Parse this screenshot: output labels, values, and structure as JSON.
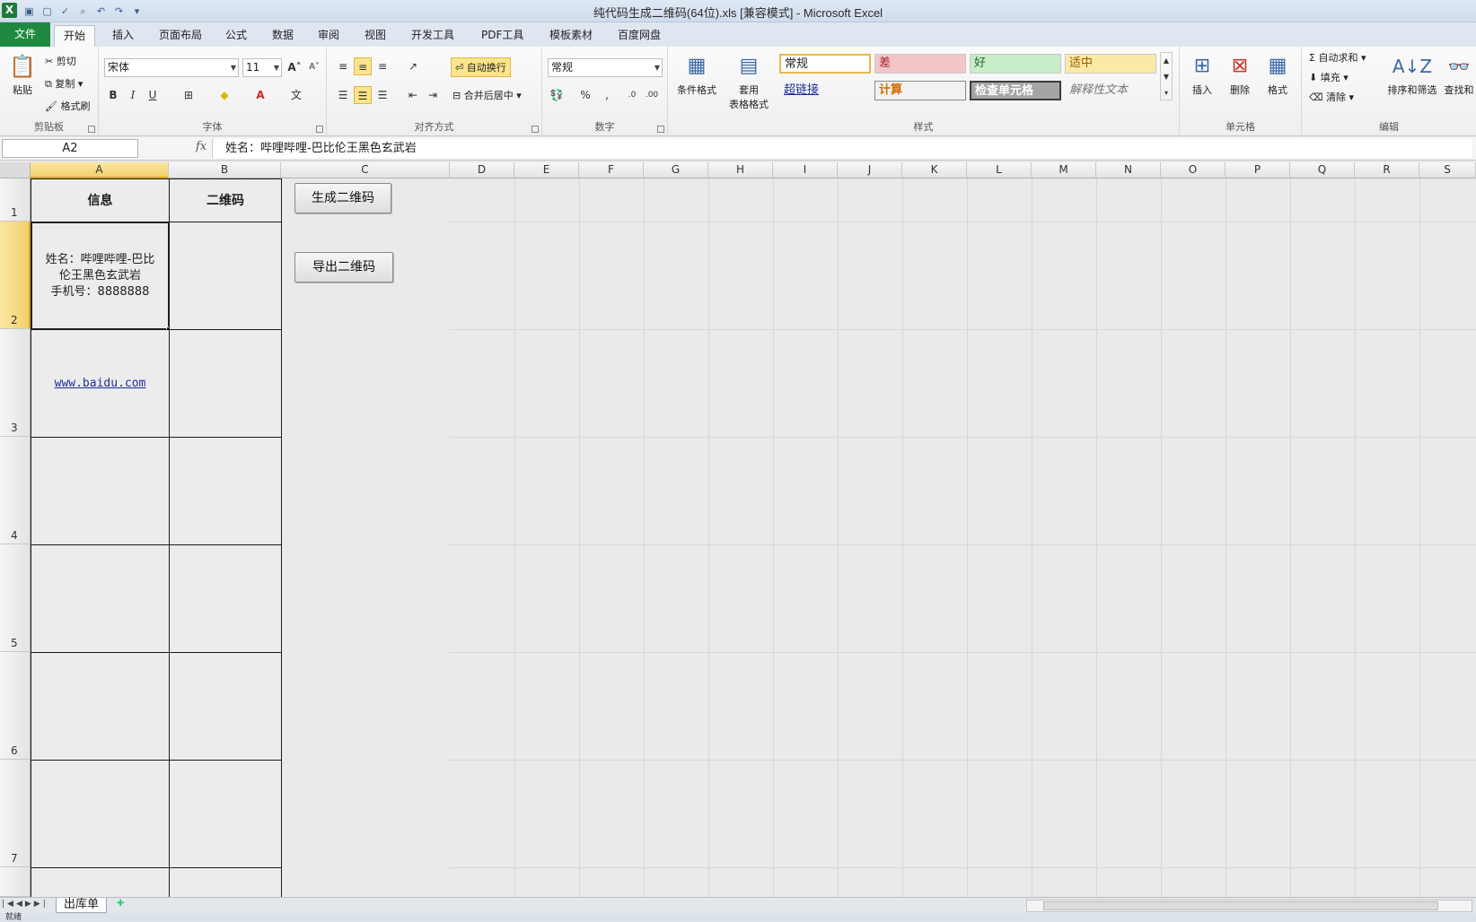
{
  "window": {
    "title": "纯代码生成二维码(64位).xls  [兼容模式] - Microsoft Excel",
    "app_icon": "X"
  },
  "tabs": [
    "文件",
    "开始",
    "插入",
    "页面布局",
    "公式",
    "数据",
    "审阅",
    "视图",
    "开发工具",
    "PDF工具",
    "模板素材",
    "百度网盘"
  ],
  "ribbon": {
    "clipboard": {
      "label": "剪贴板",
      "paste": "粘贴",
      "cut": "剪切",
      "copy": "复制",
      "format_painter": "格式刷"
    },
    "font": {
      "label": "字体",
      "name": "宋体",
      "size": "11"
    },
    "alignment": {
      "label": "对齐方式",
      "wrap": "自动换行",
      "merge": "合并后居中"
    },
    "number": {
      "label": "数字",
      "format": "常规"
    },
    "styles_group": {
      "label": "样式",
      "cond_format": "条件格式",
      "table_format_1": "套用",
      "table_format_2": "表格格式"
    },
    "cell_styles": [
      "常规",
      "差",
      "好",
      "适中",
      "超链接",
      "计算",
      "检查单元格",
      "解释性文本"
    ],
    "cells": {
      "label": "单元格",
      "insert": "插入",
      "delete": "删除",
      "format": "格式"
    },
    "editing": {
      "label": "编辑",
      "autosum": "自动求和",
      "fill": "填充",
      "clear": "清除",
      "sort": "排序和筛选",
      "find": "查找和"
    }
  },
  "formula_bar": {
    "name_box": "A2",
    "fx": "fx",
    "content": "姓名：哔哩哔哩-巴比伦王黑色玄武岩"
  },
  "columns": [
    "A",
    "B",
    "C",
    "D",
    "E",
    "F",
    "G",
    "H",
    "I",
    "J",
    "K",
    "L",
    "M",
    "N",
    "O",
    "P",
    "Q",
    "R",
    "S"
  ],
  "rows": [
    "1",
    "2",
    "3",
    "4",
    "5",
    "6",
    "7"
  ],
  "sheet": {
    "header_info": "信息",
    "header_qr": "二维码",
    "a2_line1": "姓名：哔哩哔哩-巴比",
    "a2_line2": "伦王黑色玄武岩",
    "a2_line3": "手机号：8888888",
    "a3_link": "www.baidu.com",
    "btn_generate": "生成二维码",
    "btn_export": "导出二维码"
  },
  "sheet_tabs": [
    "出库单"
  ],
  "status": "就绪",
  "colors": {
    "file_tab": "#1f8a3f",
    "selection_header": "#f4cf6b",
    "style_bad_bg": "#f2c6c9",
    "style_good_bg": "#c9ecc9",
    "style_neutral_bg": "#fbe9a6",
    "hyperlink": "#1d2f9c"
  }
}
